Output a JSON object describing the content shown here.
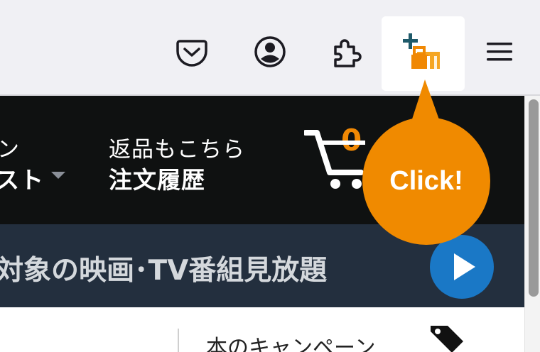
{
  "colors": {
    "toolbar_bg": "#f0f0f4",
    "nav_bg": "#0f1111",
    "banner_bg": "#232f3e",
    "accent_orange": "#f08804",
    "callout_orange": "#f08a00",
    "play_blue": "#1a78c6",
    "extension_teal": "#1f5a6a"
  },
  "toolbar": {
    "icons": [
      {
        "name": "pocket-icon"
      },
      {
        "name": "account-icon"
      },
      {
        "name": "extensions-puzzle-icon"
      },
      {
        "name": "add-to-shopping-list-extension-icon"
      },
      {
        "name": "hamburger-menu-icon"
      }
    ]
  },
  "nav": {
    "account_line1_partial": "ン",
    "account_line2_partial": "スト",
    "returns_line1": "返品もこちら",
    "returns_line2": "注文履歴",
    "cart_count": "0"
  },
  "banner": {
    "text": "対象の映画･TV番組見放題"
  },
  "subnav": {
    "text": "本のキャンペーン"
  },
  "callout": {
    "label": "Click!"
  }
}
